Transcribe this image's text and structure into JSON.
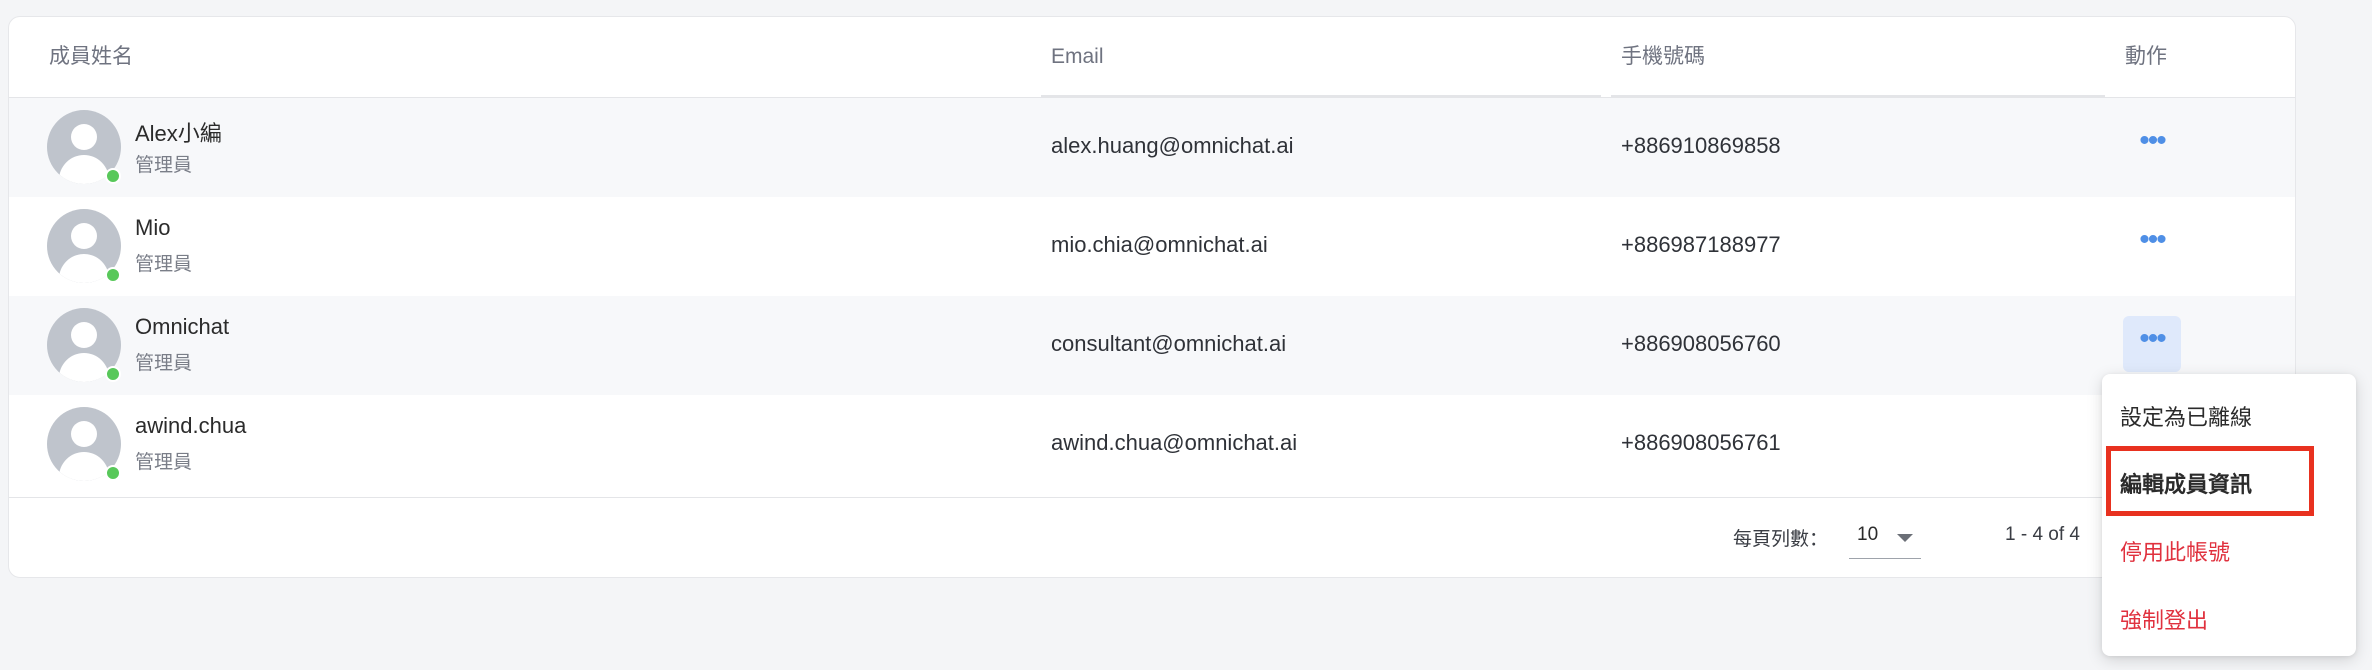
{
  "table": {
    "headers": {
      "name": "成員姓名",
      "email": "Email",
      "phone": "手機號碼",
      "action": "動作"
    },
    "rows": [
      {
        "name": "Alex小編",
        "role": "管理員",
        "email": "alex.huang@omnichat.ai",
        "phone": "+886910869858",
        "status": "online",
        "action_icon": "more-horizontal-icon"
      },
      {
        "name": "Mio",
        "role": "管理員",
        "email": "mio.chia@omnichat.ai",
        "phone": "+886987188977",
        "status": "online",
        "action_icon": "more-horizontal-icon"
      },
      {
        "name": "Omnichat",
        "role": "管理員",
        "email": "consultant@omnichat.ai",
        "phone": "+886908056760",
        "status": "online",
        "action_icon": "more-horizontal-icon"
      },
      {
        "name": "awind.chua",
        "role": "管理員",
        "email": "awind.chua@omnichat.ai",
        "phone": "+886908056761",
        "status": "online"
      }
    ]
  },
  "pagination": {
    "rows_per_page_label": "每頁列數：",
    "rows_per_page_value": "10",
    "range": "1 - 4 of 4"
  },
  "action_menu": {
    "items": [
      {
        "label": "設定為已離線",
        "style": "normal"
      },
      {
        "label": "編輯成員資訊",
        "style": "normal",
        "highlighted": true
      },
      {
        "label": "停用此帳號",
        "style": "danger"
      },
      {
        "label": "強制登出",
        "style": "danger"
      }
    ]
  },
  "colors": {
    "accent": "#4f8fe6",
    "danger": "#e0313e",
    "online": "#58c85a",
    "highlight_box": "#e8311f"
  }
}
